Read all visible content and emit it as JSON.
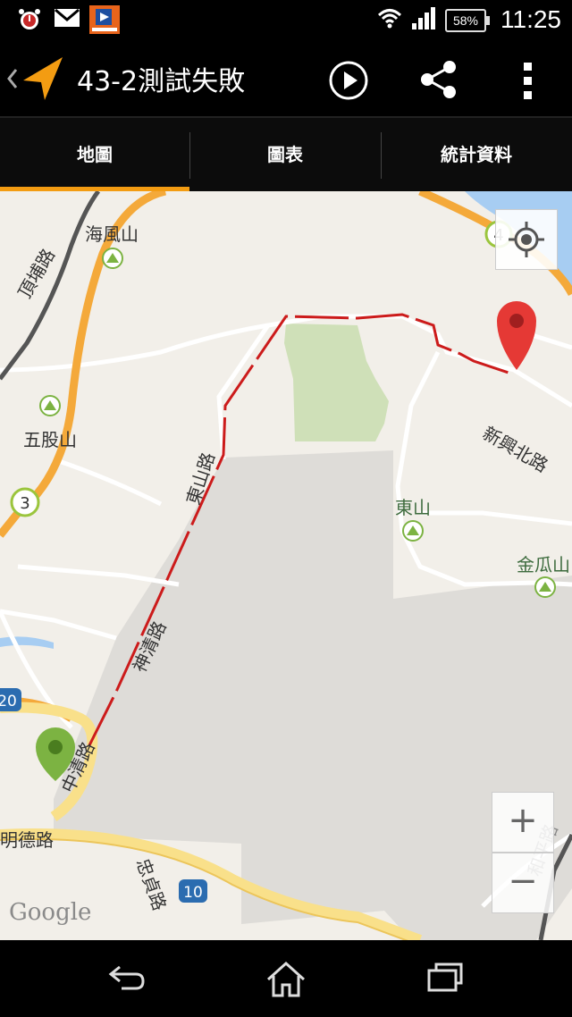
{
  "status_bar": {
    "time": "11:25",
    "battery": "58%",
    "icons": [
      "alarm-icon",
      "gmail-icon",
      "app-notification-icon",
      "wifi-icon",
      "signal-icon",
      "battery-icon"
    ]
  },
  "action_bar": {
    "title": "43-2測試失敗",
    "icons": [
      "back-chevron-icon",
      "navigation-arrow-icon",
      "play-icon",
      "share-icon",
      "overflow-menu-icon"
    ]
  },
  "tabs": [
    {
      "label": "地圖",
      "selected": true
    },
    {
      "label": "圖表",
      "selected": false
    },
    {
      "label": "統計資料",
      "selected": false
    }
  ],
  "map": {
    "labels": {
      "hai_feng_shan": "海風山",
      "ding_pu_road": "頂埔路",
      "wu_gu_shan": "五股山",
      "dong_shan_road": "東山路",
      "shen_qing_road": "神清路",
      "zhong_qing_road": "中清路",
      "ming_de_road": "明德路",
      "zhong_zhen_road": "忠貞路",
      "xin_xing_north_road": "新興北路",
      "dong_shan": "東山",
      "jin_gua_shan": "金瓜山",
      "he_ping_road": "和平路",
      "route_3": "3",
      "route_4": "4",
      "route_10": "10",
      "route_20": "20",
      "google_logo": "Google"
    },
    "zoom_in": "+",
    "zoom_out": "−",
    "colors": {
      "track": "#cc1b1b",
      "start_marker": "#7cb342",
      "end_marker": "#e53935",
      "highway": "#f4a93a",
      "major_road": "#f9e08a",
      "park": "#cfe0b8",
      "water": "#a7cdf2",
      "gray_area": "#deddd9"
    }
  },
  "nav_bar": {
    "icons": [
      "back-icon",
      "home-icon",
      "recent-apps-icon"
    ]
  }
}
